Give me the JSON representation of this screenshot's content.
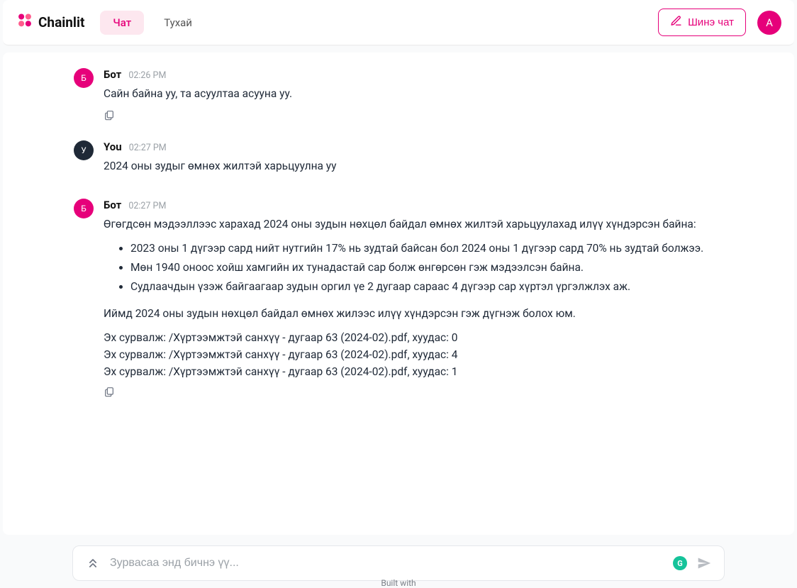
{
  "brand": {
    "name": "Chainlit"
  },
  "nav": {
    "tabs": [
      {
        "label": "Чат",
        "active": true
      },
      {
        "label": "Тухай",
        "active": false
      }
    ]
  },
  "actions": {
    "new_chat_label": "Шинэ чат",
    "user_avatar_letter": "A"
  },
  "messages": [
    {
      "avatar_letter": "Б",
      "avatar_class": "av-bot",
      "author": "Бот",
      "time": "02:26 PM",
      "paragraphs": [
        "Сайн байна уу, та асуултаа асууна уу."
      ],
      "bullets": [],
      "sources": [],
      "show_copy": true
    },
    {
      "avatar_letter": "У",
      "avatar_class": "av-you",
      "author": "You",
      "time": "02:27 PM",
      "paragraphs": [
        "2024 оны зудыг өмнөх жилтэй харьцуулна уу"
      ],
      "bullets": [],
      "sources": [],
      "show_copy": false
    },
    {
      "avatar_letter": "Б",
      "avatar_class": "av-bot",
      "author": "Бот",
      "time": "02:27 PM",
      "paragraphs": [
        "Өгөгдсөн мэдээллээс харахад 2024 оны зудын нөхцөл байдал өмнөх жилтэй харьцуулахад илүү хүндэрсэн байна:"
      ],
      "bullets": [
        "2023 оны 1 дүгээр сард нийт нутгийн 17% нь зудтай байсан бол 2024 оны 1 дүгээр сард 70% нь зудтай болжээ.",
        "Мөн 1940 оноос хойш хамгийн их тунадастай сар болж өнгөрсөн гэж мэдээлсэн байна.",
        "Судлаачдын үзэж байгаагаар зудын оргил үе 2 дугаар сараас 4 дүгээр сар хүртэл үргэлжлэх аж."
      ],
      "post_paragraphs": [
        "Иймд 2024 оны зудын нөхцөл байдал өмнөх жилээс илүү хүндэрсэн гэж дүгнэж болох юм."
      ],
      "sources": [
        "Эх сурвалж: /Хүртээмжтэй санхүү - дугаар 63 (2024-02).pdf, хуудас: 0",
        "Эх сурвалж: /Хүртээмжтэй санхүү - дугаар 63 (2024-02).pdf, хуудас: 4",
        "Эх сурвалж: /Хүртээмжтэй санхүү - дугаар 63 (2024-02).pdf, хуудас: 1"
      ],
      "show_copy": true
    }
  ],
  "composer": {
    "placeholder": "Зурвасаа энд бичнэ үү..."
  },
  "footer": {
    "built_with_prefix": "Built with"
  },
  "colors": {
    "accent": "#e6007a"
  }
}
